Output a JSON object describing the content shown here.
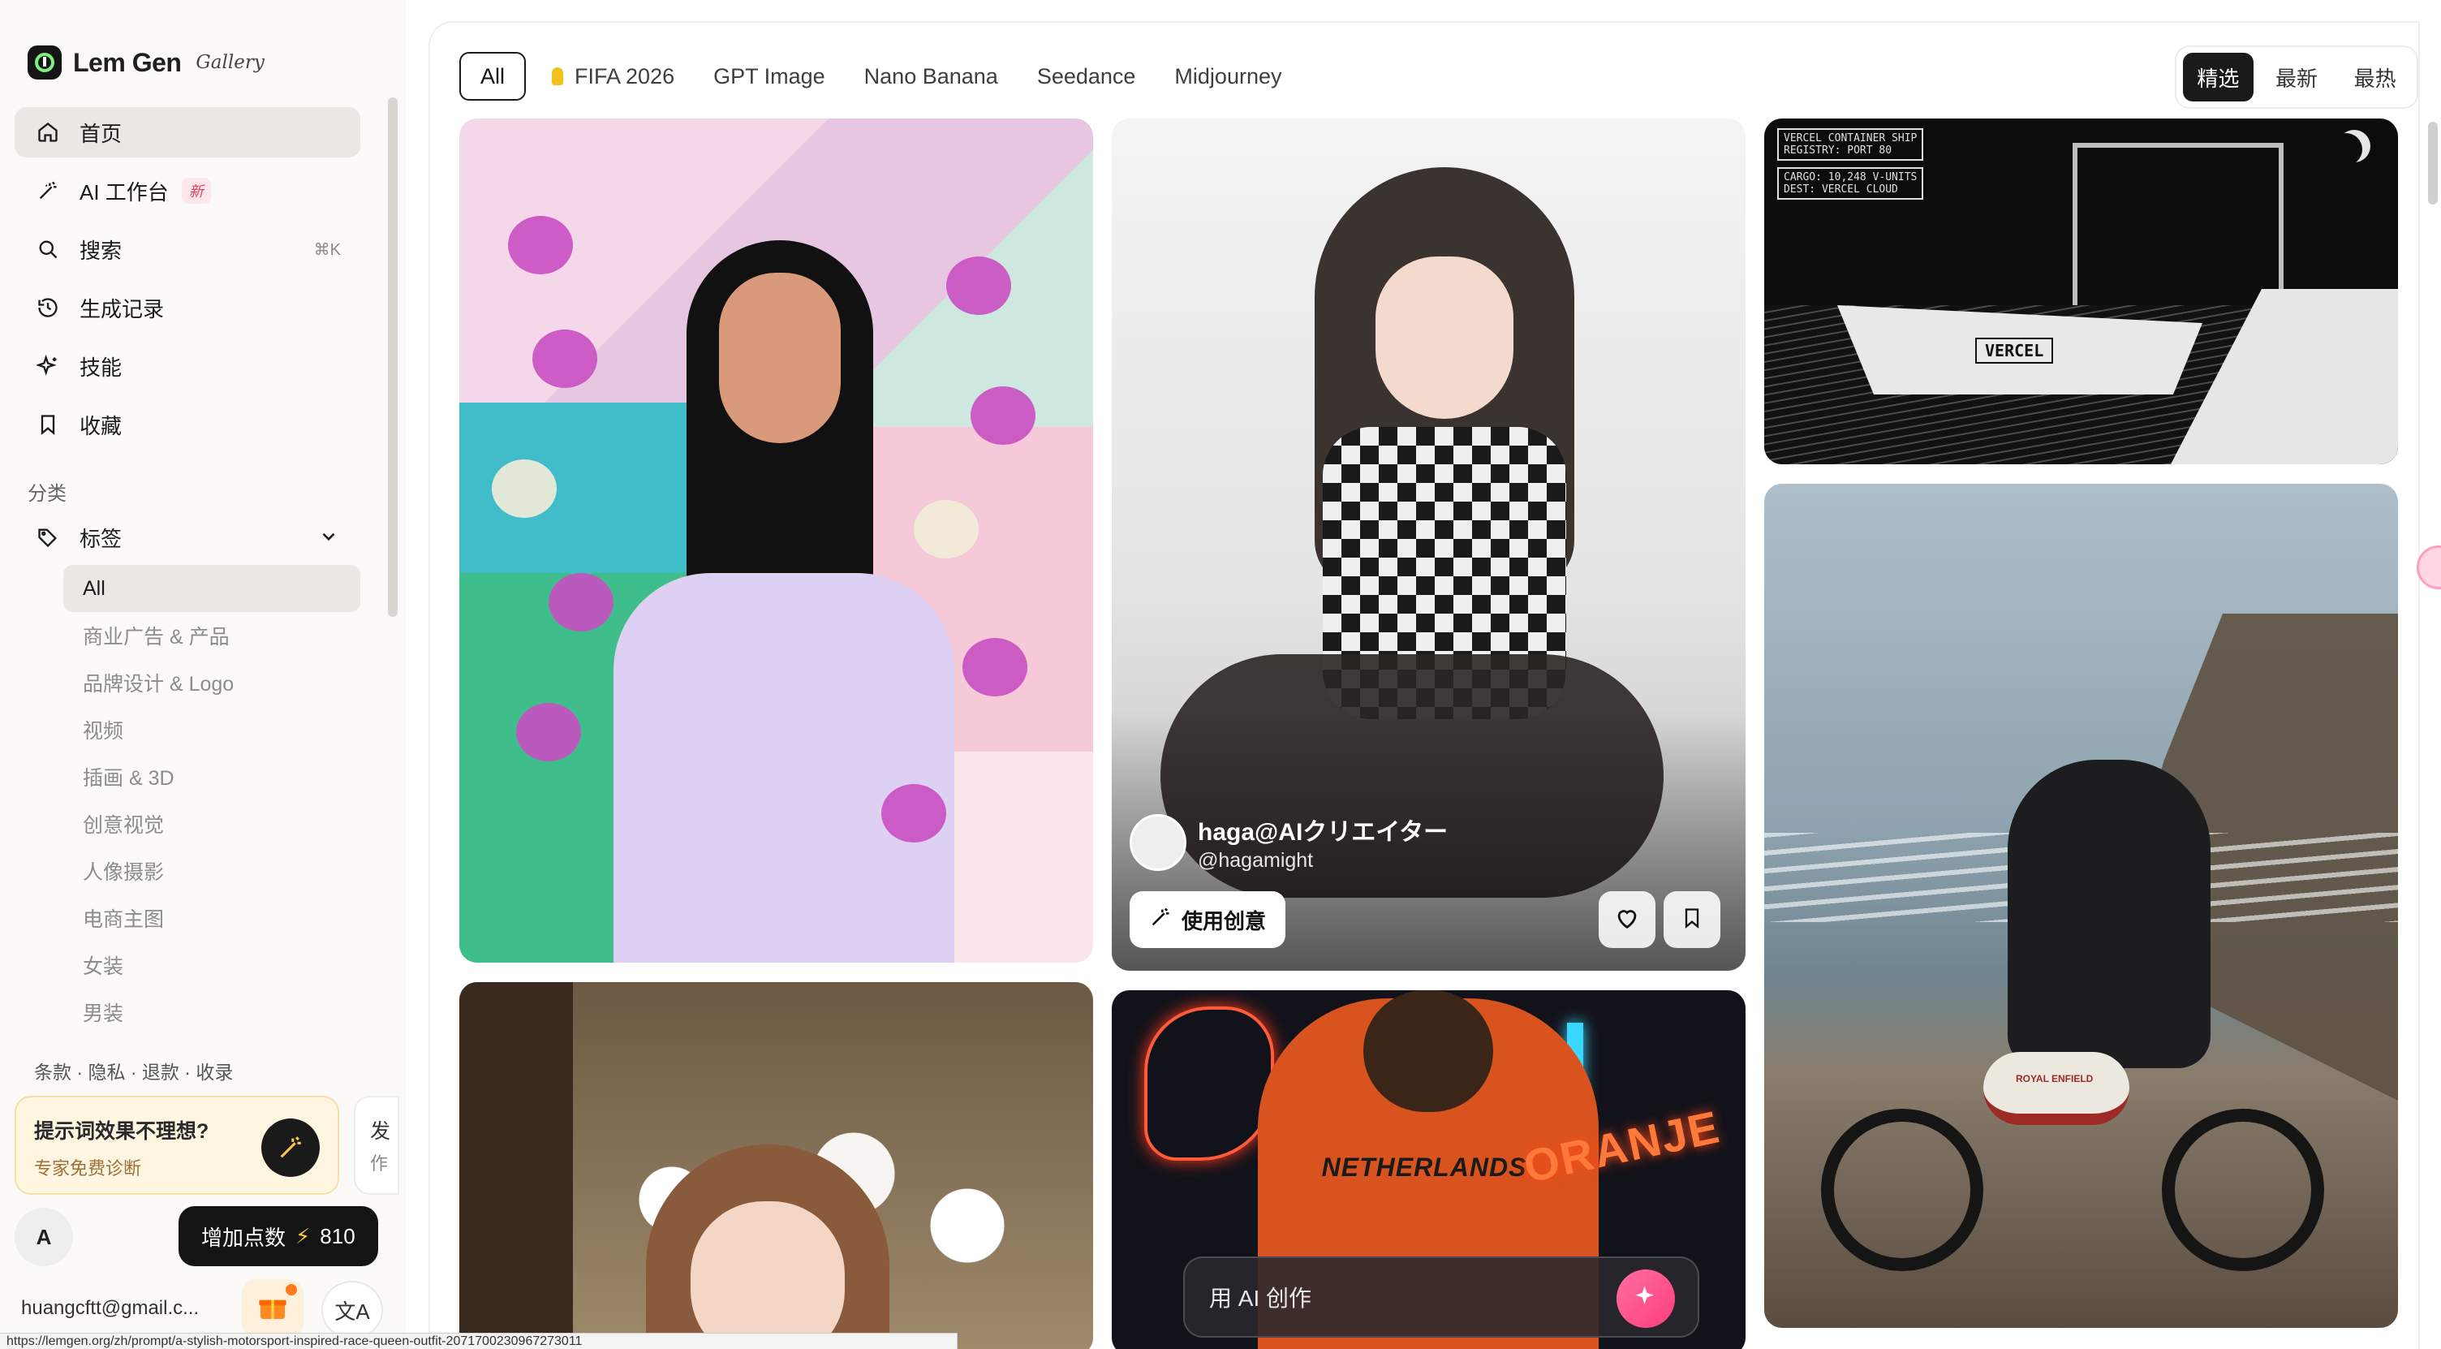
{
  "app": {
    "logo_text": "Lem Gen",
    "logo_sub": "Gallery"
  },
  "sidebar": {
    "nav": [
      {
        "label": "首页",
        "icon": "home-icon"
      },
      {
        "label": "AI 工作台",
        "icon": "magic-wand-icon",
        "badge": "新"
      },
      {
        "label": "搜索",
        "icon": "search-icon",
        "shortcut": "⌘K"
      },
      {
        "label": "生成记录",
        "icon": "history-icon"
      },
      {
        "label": "技能",
        "icon": "sparkle-icon"
      },
      {
        "label": "收藏",
        "icon": "bookmark-icon"
      }
    ],
    "section_label": "分类",
    "tags_label": "标签",
    "tags": [
      "All",
      "商业广告 & 产品",
      "品牌设计 & Logo",
      "视频",
      "插画 & 3D",
      "创意视觉",
      "人像摄影",
      "电商主图",
      "女装",
      "男装"
    ],
    "legal": "条款 · 隐私 · 退款 · 收录",
    "promo": {
      "title": "提示词效果不理想?",
      "subtitle": "专家免费诊断"
    },
    "promo2": {
      "line1": "发",
      "line2": "作"
    },
    "user": {
      "initial": "A",
      "email": "huangcftt@gmail.c..."
    },
    "credits": {
      "label": "增加点数",
      "bolt": "⚡",
      "value": "810"
    },
    "lang_glyph": "文A"
  },
  "filters": {
    "items": [
      "All",
      "FIFA 2026",
      "GPT Image",
      "Nano Banana",
      "Seedance",
      "Midjourney"
    ],
    "active": "All"
  },
  "sort": {
    "items": [
      "精选",
      "最新",
      "最热"
    ],
    "active": "精选"
  },
  "cards": {
    "featured": {
      "author_name": "haga@AIクリエイター",
      "author_handle": "@hagamight",
      "use_label": "使用创意"
    },
    "ship_labels": {
      "top": "VERCEL CONTAINER SHIP\nREGISTRY: PORT 80",
      "bottom": "CARGO: 10,248 V-UNITS\nDEST: VERCEL CLOUD",
      "ship_name": "VERCEL"
    },
    "soccer": {
      "jersey": "NETHERLANDS",
      "sign": "ORANJE"
    },
    "bike": {
      "badge": "ROYAL ENFIELD"
    }
  },
  "create_bar": {
    "placeholder": "用 AI 创作"
  },
  "status_url": "https://lemgen.org/zh/prompt/a-stylish-motorsport-inspired-race-queen-outfit-2071700230967273011"
}
